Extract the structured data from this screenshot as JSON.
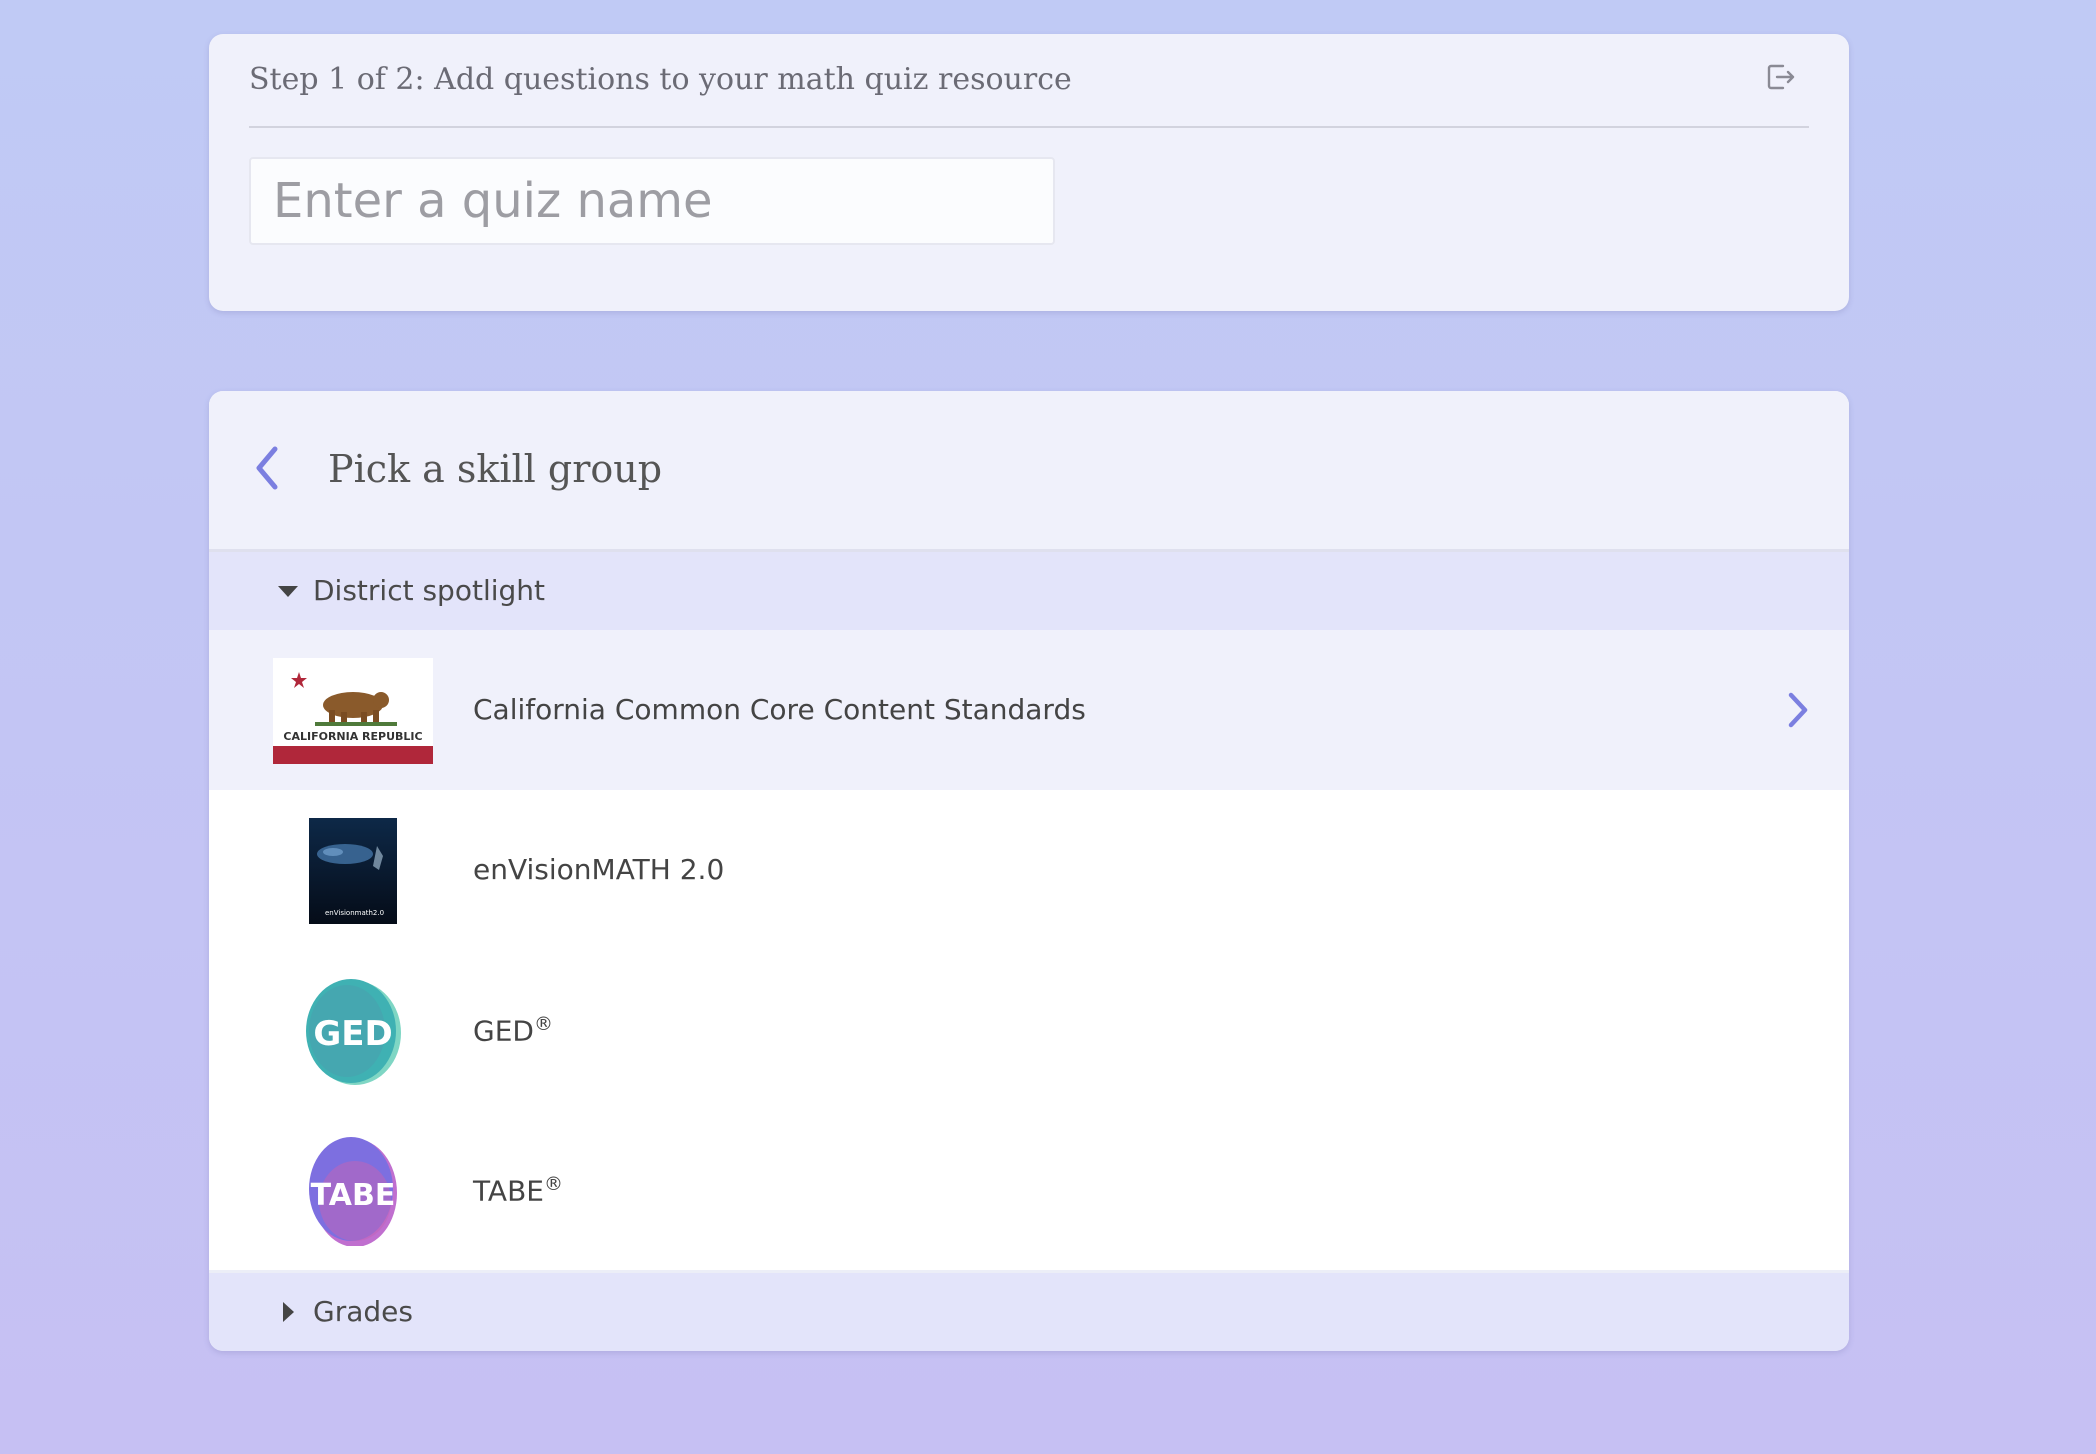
{
  "header": {
    "step_title": "Step 1 of 2: Add questions to your math quiz resource",
    "exit_icon": "exit-icon"
  },
  "quiz_name": {
    "value": "",
    "placeholder": "Enter a quiz name"
  },
  "picker": {
    "title": "Pick a skill group",
    "back_icon": "chevron-left-icon",
    "accent_color": "#7b7fe0"
  },
  "sections": [
    {
      "label": "District spotlight",
      "expanded": true,
      "items": [
        {
          "name": "California Common Core Content Standards",
          "selected": true,
          "icon": "california-flag-icon",
          "flag_text": "CALIFORNIA REPUBLIC"
        },
        {
          "name": "enVisionMATH 2.0",
          "selected": false,
          "icon": "envisionmath-cover-icon",
          "cover_text": "enVisionmath2.0"
        },
        {
          "name": "GED",
          "mark": "®",
          "selected": false,
          "icon": "ged-logo-icon",
          "logo_text": "GED"
        },
        {
          "name": "TABE",
          "mark": "®",
          "selected": false,
          "icon": "tabe-logo-icon",
          "logo_text": "TABE"
        }
      ]
    },
    {
      "label": "Grades",
      "expanded": false,
      "items": []
    }
  ]
}
